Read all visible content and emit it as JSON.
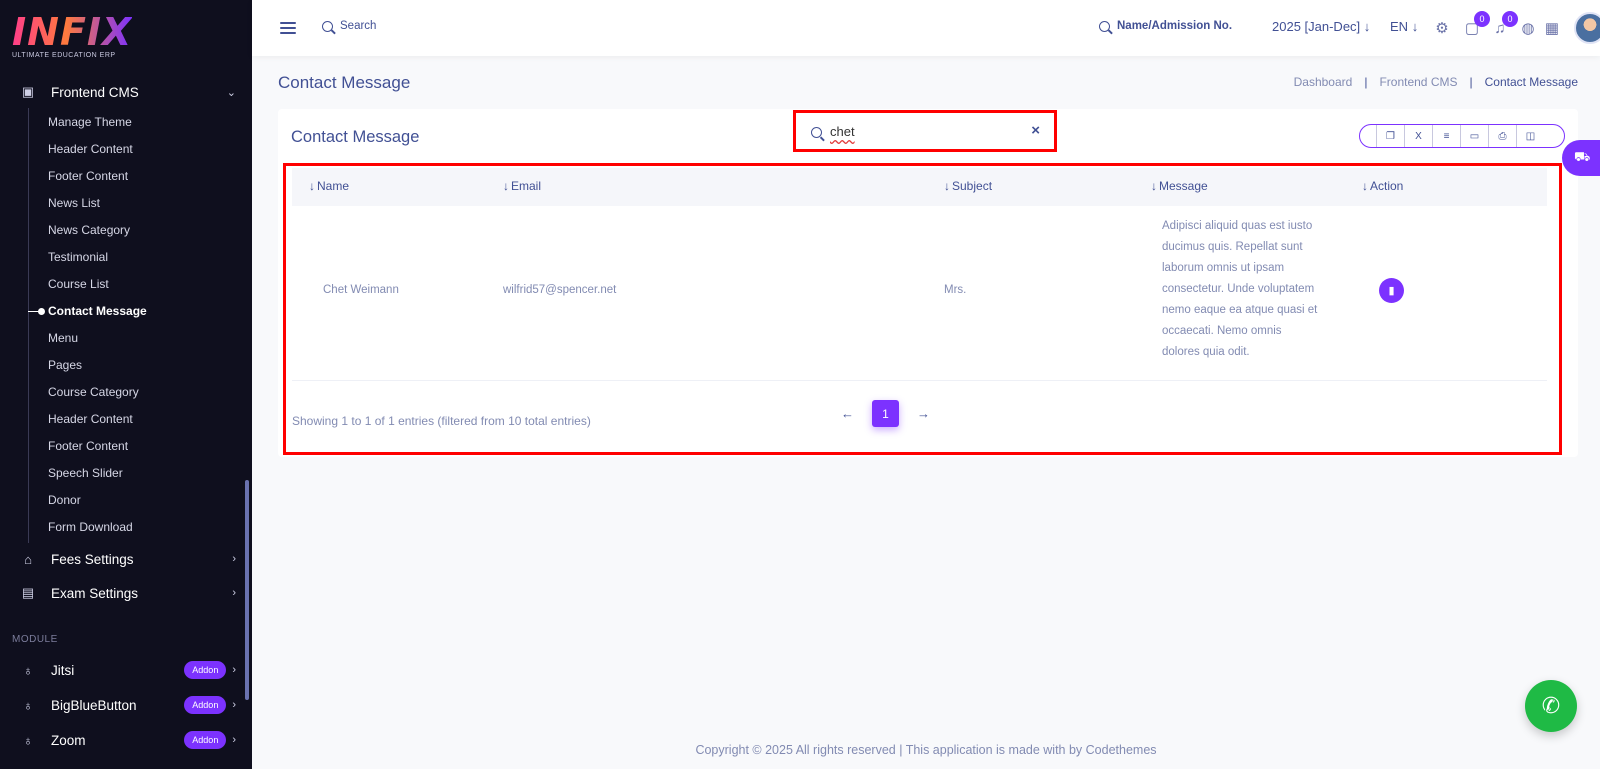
{
  "logo": {
    "mark": "INFIX",
    "tagline": "ULTIMATE EDUCATION ERP"
  },
  "sidebar": {
    "parent": "Frontend CMS",
    "items": [
      {
        "label": "Manage Theme"
      },
      {
        "label": "Header Content"
      },
      {
        "label": "Footer Content"
      },
      {
        "label": "News List"
      },
      {
        "label": "News Category"
      },
      {
        "label": "Testimonial"
      },
      {
        "label": "Course List"
      },
      {
        "label": "Contact Message",
        "active": true
      },
      {
        "label": "Menu"
      },
      {
        "label": "Pages"
      },
      {
        "label": "Course Category"
      },
      {
        "label": "Header Content"
      },
      {
        "label": "Footer Content"
      },
      {
        "label": "Speech Slider"
      },
      {
        "label": "Donor"
      },
      {
        "label": "Form Download"
      }
    ],
    "fees_settings": "Fees Settings",
    "exam_settings": "Exam Settings",
    "module_label": "MODULE",
    "modules": [
      {
        "label": "Jitsi",
        "badge": "Addon"
      },
      {
        "label": "BigBlueButton",
        "badge": "Addon"
      },
      {
        "label": "Zoom",
        "badge": "Addon"
      }
    ]
  },
  "header": {
    "search_label": "Search",
    "admission_search": "Name/Admission No.",
    "academic_year": "2025 [Jan-Dec]",
    "language": "EN",
    "chat_badge": "0",
    "notification_badge": "0"
  },
  "page": {
    "title": "Contact Message",
    "breadcrumb": [
      "Dashboard",
      "Frontend CMS",
      "Contact Message"
    ]
  },
  "card": {
    "title": "Contact Message",
    "search_value": "chet",
    "columns": [
      "Name",
      "Email",
      "Subject",
      "Message",
      "Action"
    ],
    "rows": [
      {
        "name": "Chet Weimann",
        "email": "wilfrid57@spencer.net",
        "subject": "Mrs.",
        "message": "Adipisci aliquid quas est iusto ducimus quis. Repellat sunt laborum omnis ut ipsam consectetur. Unde voluptatem nemo eaque ea atque quasi et occaecati. Nemo omnis dolores quia odit."
      }
    ],
    "info": "Showing 1 to 1 of 1 entries (filtered from 10 total entries)",
    "current_page": "1"
  },
  "footer": "Copyright © 2025 All rights reserved | This application is made with by Codethemes",
  "colors": {
    "accent": "#7c32ff",
    "sidebar_bg": "#0f0f1e",
    "text": "#415094",
    "highlight": "#ff0000",
    "whatsapp": "#1fba45"
  }
}
